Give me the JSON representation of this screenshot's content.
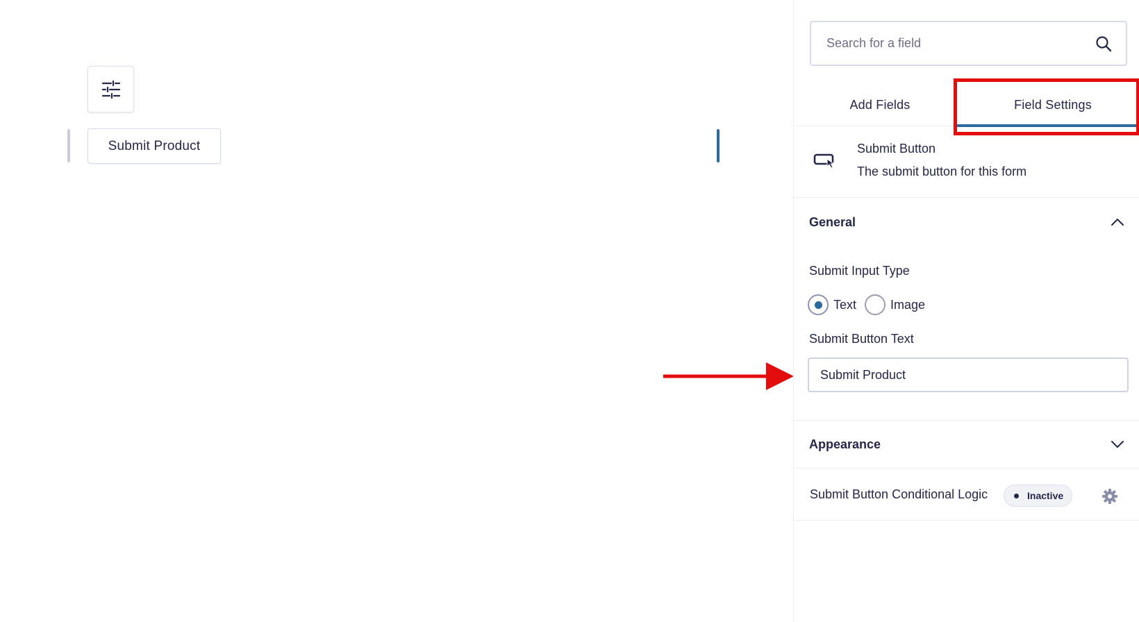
{
  "canvas": {
    "toolbar_icon": "sliders-icon",
    "submit_preview_label": "Submit Product"
  },
  "sidebar": {
    "search": {
      "placeholder": "Search for a field",
      "value": "",
      "icon": "search-icon"
    },
    "tabs": [
      {
        "label": "Add Fields",
        "active": false
      },
      {
        "label": "Field Settings",
        "active": true
      }
    ],
    "field_info": {
      "icon": "submit-button-icon",
      "title": "Submit Button",
      "description": "The submit button for this form"
    },
    "general": {
      "title": "General",
      "expanded": true,
      "input_type_label": "Submit Input Type",
      "input_type_options": [
        {
          "label": "Text",
          "checked": true
        },
        {
          "label": "Image",
          "checked": false
        }
      ],
      "button_text_label": "Submit Button Text",
      "button_text_value": "Submit Product"
    },
    "appearance": {
      "title": "Appearance",
      "expanded": false
    },
    "conditional_logic": {
      "label": "Submit Button Conditional Logic",
      "status": "Inactive"
    }
  },
  "colors": {
    "accent": "#2b6a9c",
    "annotation": "#e40d0d",
    "text": "#242748",
    "border": "#d9dce7"
  }
}
